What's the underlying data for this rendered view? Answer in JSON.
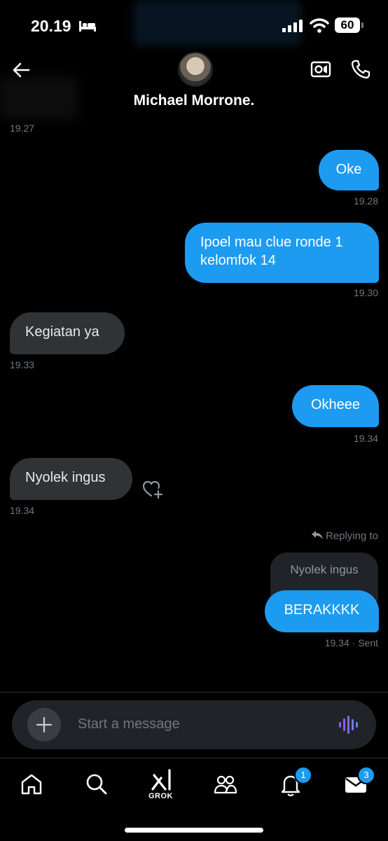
{
  "status_bar": {
    "time": "20.19",
    "battery": "60"
  },
  "header": {
    "contact_name": "Michael Morrone."
  },
  "messages": [
    {
      "type": "timestamp_only",
      "time": "19.27"
    },
    {
      "dir": "out",
      "text": "Oke",
      "time": "19.28"
    },
    {
      "dir": "out",
      "text": "Ipoel mau clue ronde 1 kelomfok 14",
      "time": "19.30"
    },
    {
      "dir": "in",
      "text": "Kegiatan ya",
      "time": "19.33"
    },
    {
      "dir": "out",
      "text": "Okheee",
      "time": "19.34"
    },
    {
      "dir": "in",
      "text": "Nyolek ingus",
      "time": "19.34"
    },
    {
      "dir": "out",
      "reply_label": "Replying to",
      "quoted": "Nyolek ingus",
      "text": "BERAKKKK",
      "time": "19.34 · Sent"
    }
  ],
  "composer": {
    "placeholder": "Start a message"
  },
  "tabbar": {
    "grok_label": "GROK",
    "notifications_badge": "1",
    "messages_badge": "3"
  },
  "colors": {
    "accent": "#1d9bf0",
    "incoming_bubble": "#2f3336",
    "background": "#000000",
    "voice_icon": "#8b5cf6"
  }
}
